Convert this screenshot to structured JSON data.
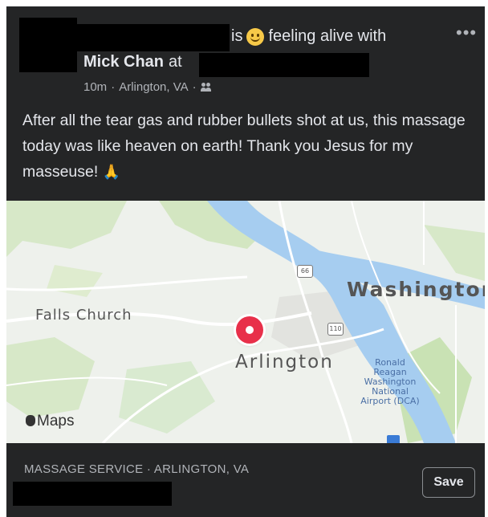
{
  "post": {
    "header": {
      "is_label": "is",
      "emoji": "slightly-smiling-emoji",
      "feeling_label": "feeling alive with",
      "tagged_name": "Mick Chan",
      "at_label": "at",
      "more_icon": "more-horizontal-icon"
    },
    "meta": {
      "time": "10m",
      "separator": "·",
      "location": "Arlington, VA",
      "separator2": "·",
      "audience_icon": "friends-icon"
    },
    "text": "After all the tear gas and rubber bullets shot at us, this massage today was like heaven on earth! Thank you Jesus for my masseuse!",
    "text_emoji": "🙏"
  },
  "map": {
    "labels": {
      "washington": "Washington",
      "falls_church": "Falls Church",
      "arlington": "Arlington",
      "airport": "Ronald Reagan Washington National Airport (DCA)"
    },
    "shields": {
      "route_66": "66",
      "route_110": "110"
    },
    "attribution": "Maps",
    "colors": {
      "water": "#a6cdf0",
      "park": "#c9e2b4",
      "pin": "#e8304a"
    }
  },
  "footer": {
    "category": "MASSAGE SERVICE · ARLINGTON, VA",
    "save_label": "Save"
  }
}
